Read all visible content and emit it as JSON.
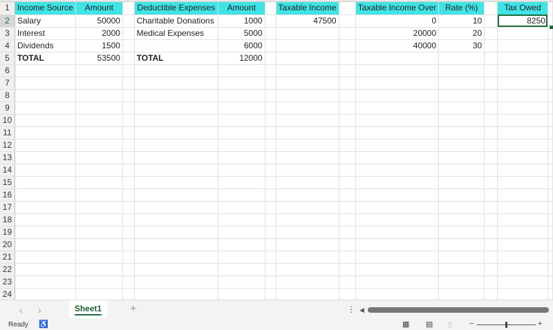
{
  "sheet": {
    "row_numbers": [
      "1",
      "2",
      "3",
      "4",
      "5",
      "6",
      "7",
      "8",
      "9",
      "10",
      "11",
      "12",
      "13",
      "14",
      "15",
      "16",
      "17",
      "18",
      "19",
      "20",
      "21",
      "22",
      "23",
      "24"
    ],
    "rows": [
      [
        "Income Source",
        "Amount",
        "",
        "Deductible Expenses",
        "Amount",
        "",
        "Taxable Income",
        "",
        "Taxable Income Over",
        "Rate (%)",
        "",
        "Tax Owed",
        ""
      ],
      [
        "Salary",
        "50000",
        "",
        "Charitable Donations",
        "1000",
        "",
        "47500",
        "",
        "0",
        "10",
        "",
        "8250",
        ""
      ],
      [
        "Interest",
        "2000",
        "",
        "Medical Expenses",
        "5000",
        "",
        "",
        "",
        "20000",
        "20",
        "",
        "",
        ""
      ],
      [
        "Dividends",
        "1500",
        "",
        "",
        "6000",
        "",
        "",
        "",
        "40000",
        "30",
        "",
        "",
        ""
      ],
      [
        "TOTAL",
        "53500",
        "",
        "TOTAL",
        "12000",
        "",
        "",
        "",
        "",
        "",
        "",
        "",
        ""
      ]
    ],
    "active_cell": "L2"
  },
  "tabs": {
    "sheets": [
      "Sheet1"
    ],
    "add_label": "+",
    "prev": "‹",
    "next": "›"
  },
  "status": {
    "ready": "Ready"
  },
  "colors": {
    "header_fill": "#40e3e6",
    "accent": "#1e6b3e"
  }
}
